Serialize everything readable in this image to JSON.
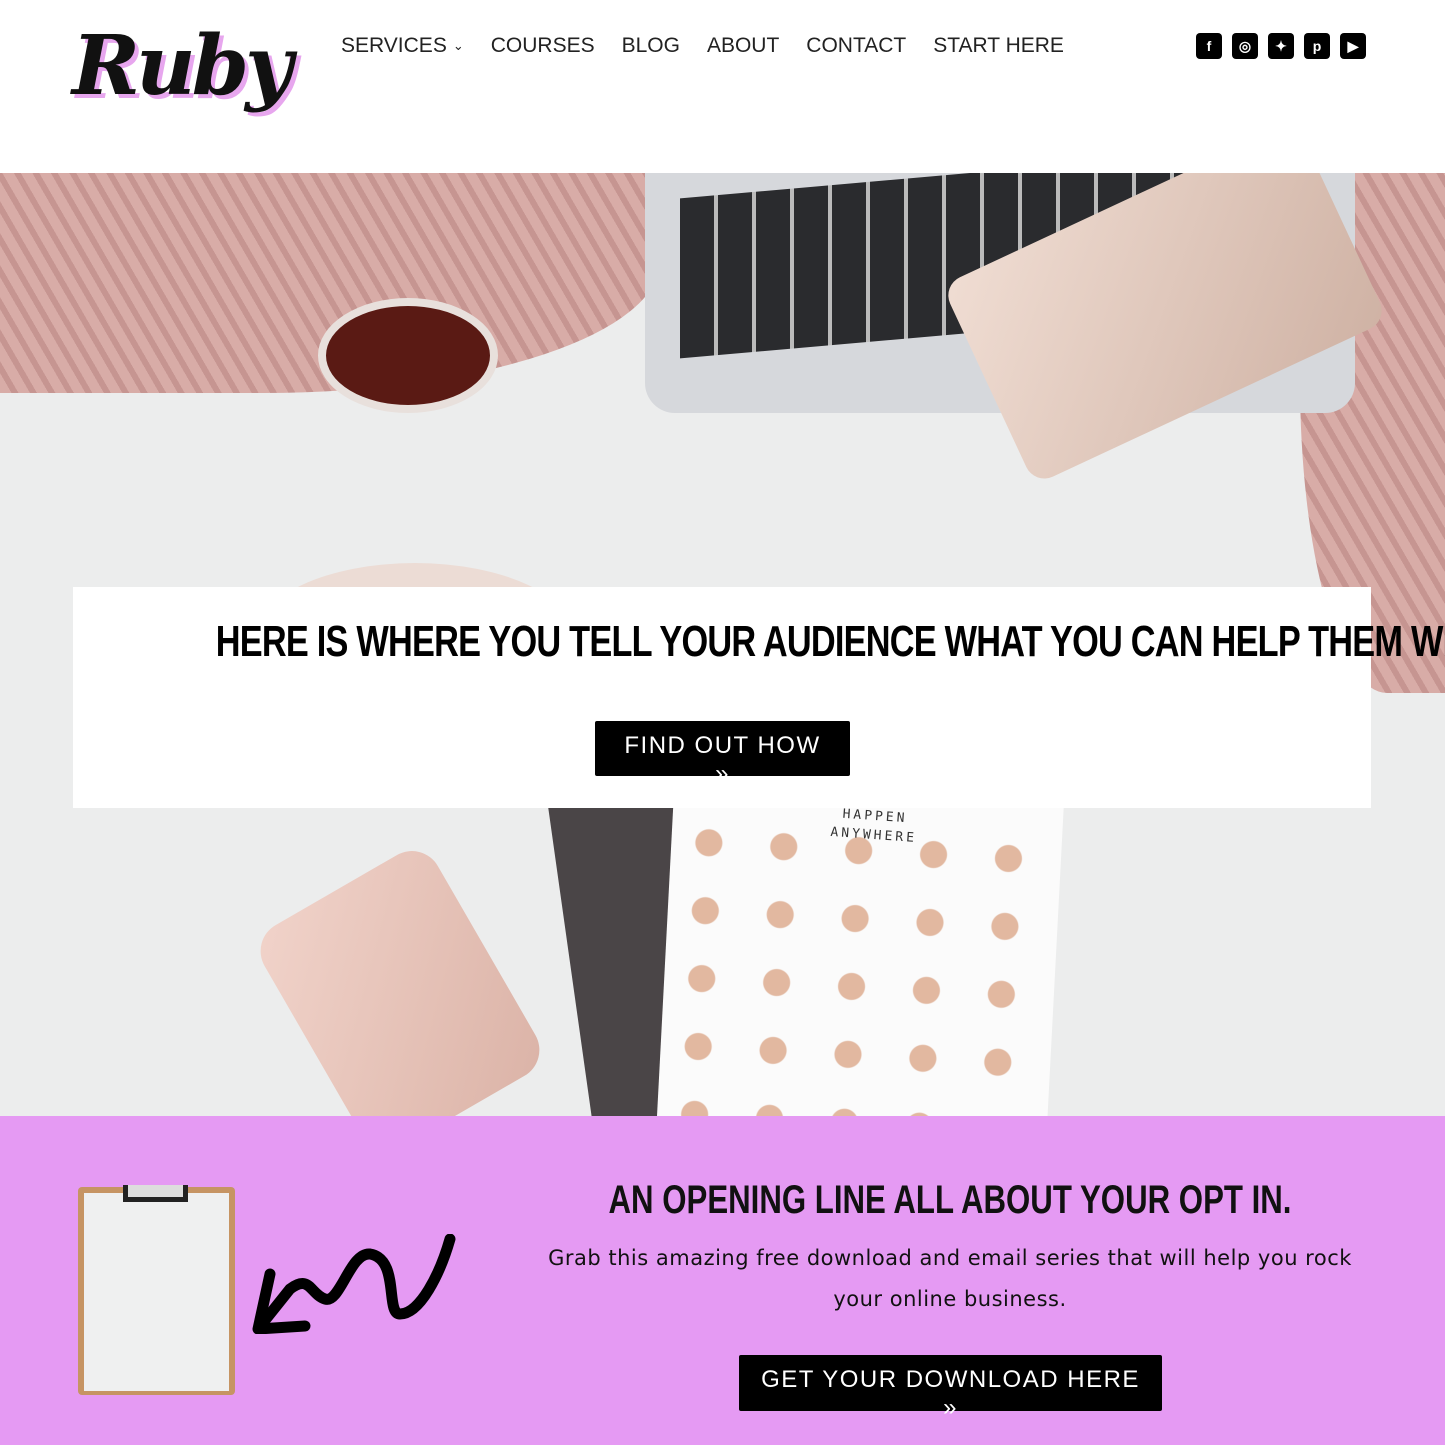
{
  "header": {
    "logo": "Ruby",
    "nav": [
      "SERVICES",
      "COURSES",
      "BLOG",
      "ABOUT",
      "CONTACT",
      "START HERE"
    ],
    "social": [
      {
        "icon": "facebook-icon",
        "glyph": "f"
      },
      {
        "icon": "instagram-icon",
        "glyph": "◎"
      },
      {
        "icon": "twitter-icon",
        "glyph": "🐦"
      },
      {
        "icon": "pinterest-icon",
        "glyph": "p"
      },
      {
        "icon": "youtube-icon",
        "glyph": "▶"
      }
    ]
  },
  "hero": {
    "title": "HERE IS WHERE YOU TELL YOUR AUDIENCE WHAT YOU CAN HELP THEM WITH",
    "button": "FIND OUT HOW  »",
    "notebook_text": "IDEAS CAN HAPPEN ANYWHERE"
  },
  "optin": {
    "title": "AN OPENING LINE ALL ABOUT YOUR OPT IN.",
    "text": "Grab this amazing free download and email series that will help you rock your online business.",
    "button": "GET YOUR DOWNLOAD HERE  »",
    "background": "#e59af3"
  }
}
